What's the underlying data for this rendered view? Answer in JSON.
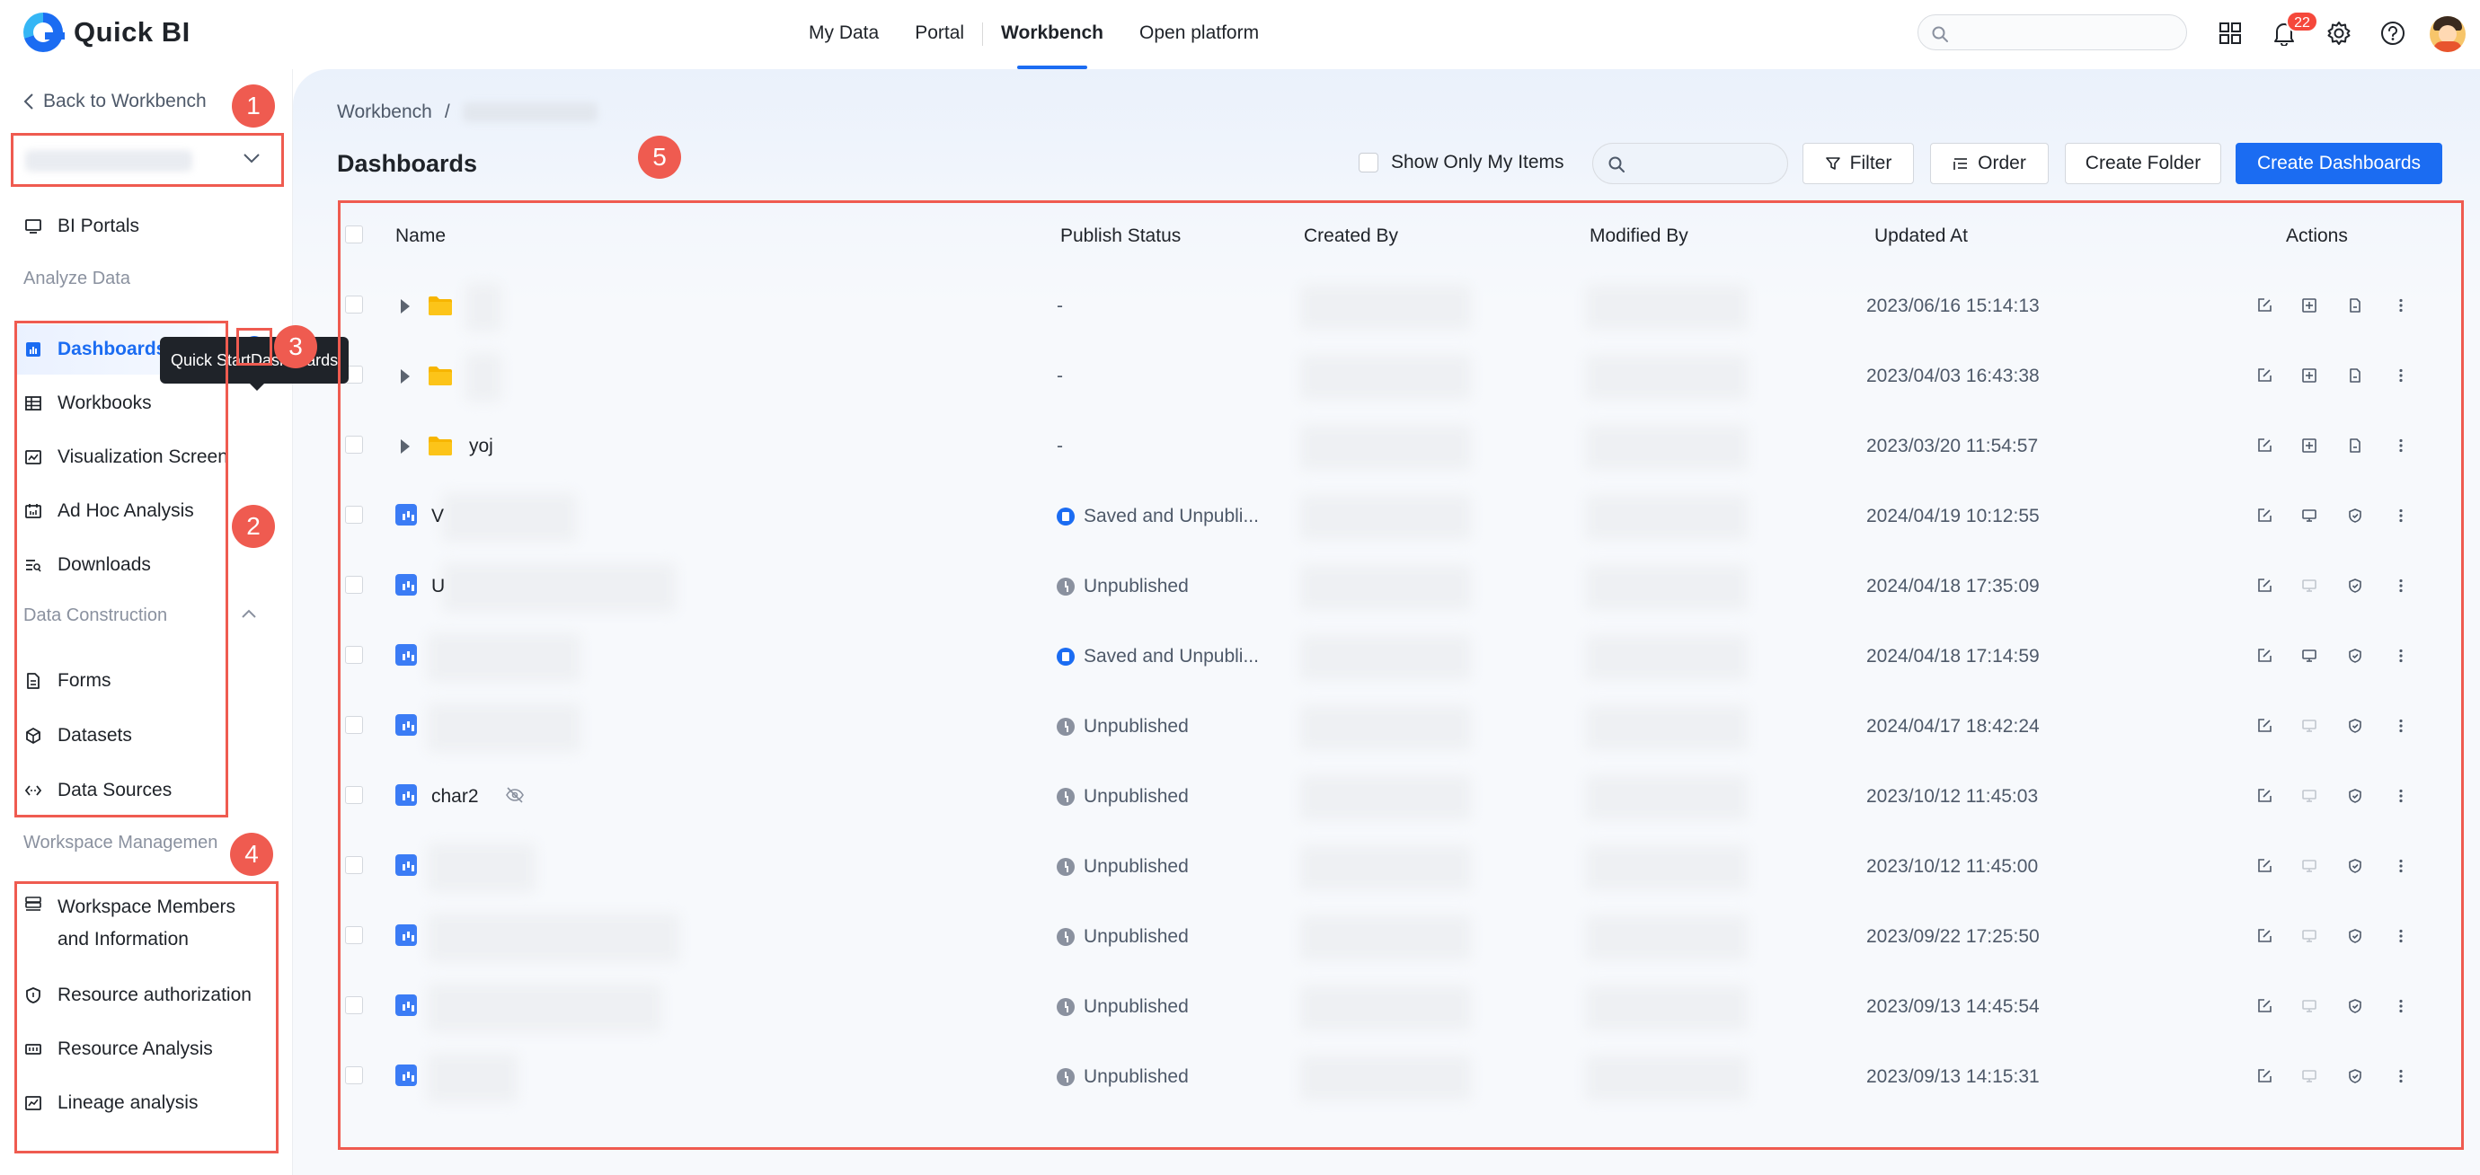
{
  "app": {
    "logo_text": "Quick BI",
    "brand_color": "#1b6cf2",
    "notification_count": "22"
  },
  "nav": {
    "tabs": [
      {
        "label": "My Data"
      },
      {
        "label": "Portal"
      },
      {
        "label": "Workbench",
        "active": true
      },
      {
        "label": "Open platform"
      }
    ],
    "icons": [
      "grid-apps-icon",
      "bell-icon",
      "gear-icon",
      "help-icon",
      "avatar"
    ]
  },
  "sidebar": {
    "back_label": "Back to Workbench",
    "items": {
      "bi_portals": "BI Portals",
      "analyze_data_section": "Analyze Data",
      "dashboards": "Dashboards",
      "workbooks": "Workbooks",
      "visualization": "Visualization Screen",
      "adhoc": "Ad Hoc Analysis",
      "downloads": "Downloads",
      "data_construction_section": "Data Construction",
      "forms": "Forms",
      "datasets": "Datasets",
      "data_sources": "Data Sources",
      "workspace_mgmt_section": "Workspace Managemen",
      "members_line1": "Workspace Members",
      "members_line2": "and Information",
      "resource_auth": "Resource authorization",
      "resource_analysis": "Resource Analysis",
      "lineage": "Lineage analysis"
    },
    "tooltip": "Quick StartDashboards"
  },
  "annotations": [
    "1",
    "2",
    "3",
    "4",
    "5"
  ],
  "main": {
    "breadcrumb_root": "Workbench",
    "breadcrumb_sep": "/",
    "title": "Dashboards",
    "show_only_label": "Show Only My Items",
    "filter_label": "Filter",
    "order_label": "Order",
    "create_folder_label": "Create Folder",
    "create_dashboards_label": "Create Dashboards"
  },
  "table": {
    "headers": {
      "name": "Name",
      "publish_status": "Publish Status",
      "created_by": "Created By",
      "modified_by": "Modified By",
      "updated_at": "Updated At",
      "actions": "Actions"
    },
    "rows": [
      {
        "type": "folder",
        "name": "",
        "status": "-",
        "updated": "2023/06/16 15:14:13"
      },
      {
        "type": "folder",
        "name": "",
        "status": "-",
        "updated": "2023/04/03 16:43:38"
      },
      {
        "type": "folder",
        "name": "yoj",
        "status": "-",
        "updated": "2023/03/20 11:54:57"
      },
      {
        "type": "dashboard",
        "name": "V",
        "status": "Saved and Unpubli...",
        "status_kind": "saved",
        "updated": "2024/04/19 10:12:55"
      },
      {
        "type": "dashboard",
        "name": "U",
        "status": "Unpublished",
        "status_kind": "unpublished",
        "updated": "2024/04/18 17:35:09"
      },
      {
        "type": "dashboard",
        "name": "",
        "status": "Saved and Unpubli...",
        "status_kind": "saved",
        "updated": "2024/04/18 17:14:59"
      },
      {
        "type": "dashboard",
        "name": "",
        "status": "Unpublished",
        "status_kind": "unpublished",
        "updated": "2024/04/17 18:42:24"
      },
      {
        "type": "dashboard",
        "name": "char2",
        "status": "Unpublished",
        "status_kind": "unpublished",
        "updated": "2023/10/12 11:45:03"
      },
      {
        "type": "dashboard",
        "name": "",
        "status": "Unpublished",
        "status_kind": "unpublished",
        "updated": "2023/10/12 11:45:00"
      },
      {
        "type": "dashboard",
        "name": "",
        "status": "Unpublished",
        "status_kind": "unpublished",
        "updated": "2023/09/22 17:25:50"
      },
      {
        "type": "dashboard",
        "name": "",
        "status": "Unpublished",
        "status_kind": "unpublished",
        "updated": "2023/09/13 14:45:54"
      },
      {
        "type": "dashboard",
        "name": "",
        "status": "Unpublished",
        "status_kind": "unpublished",
        "updated": "2023/09/13 14:15:31"
      }
    ]
  }
}
